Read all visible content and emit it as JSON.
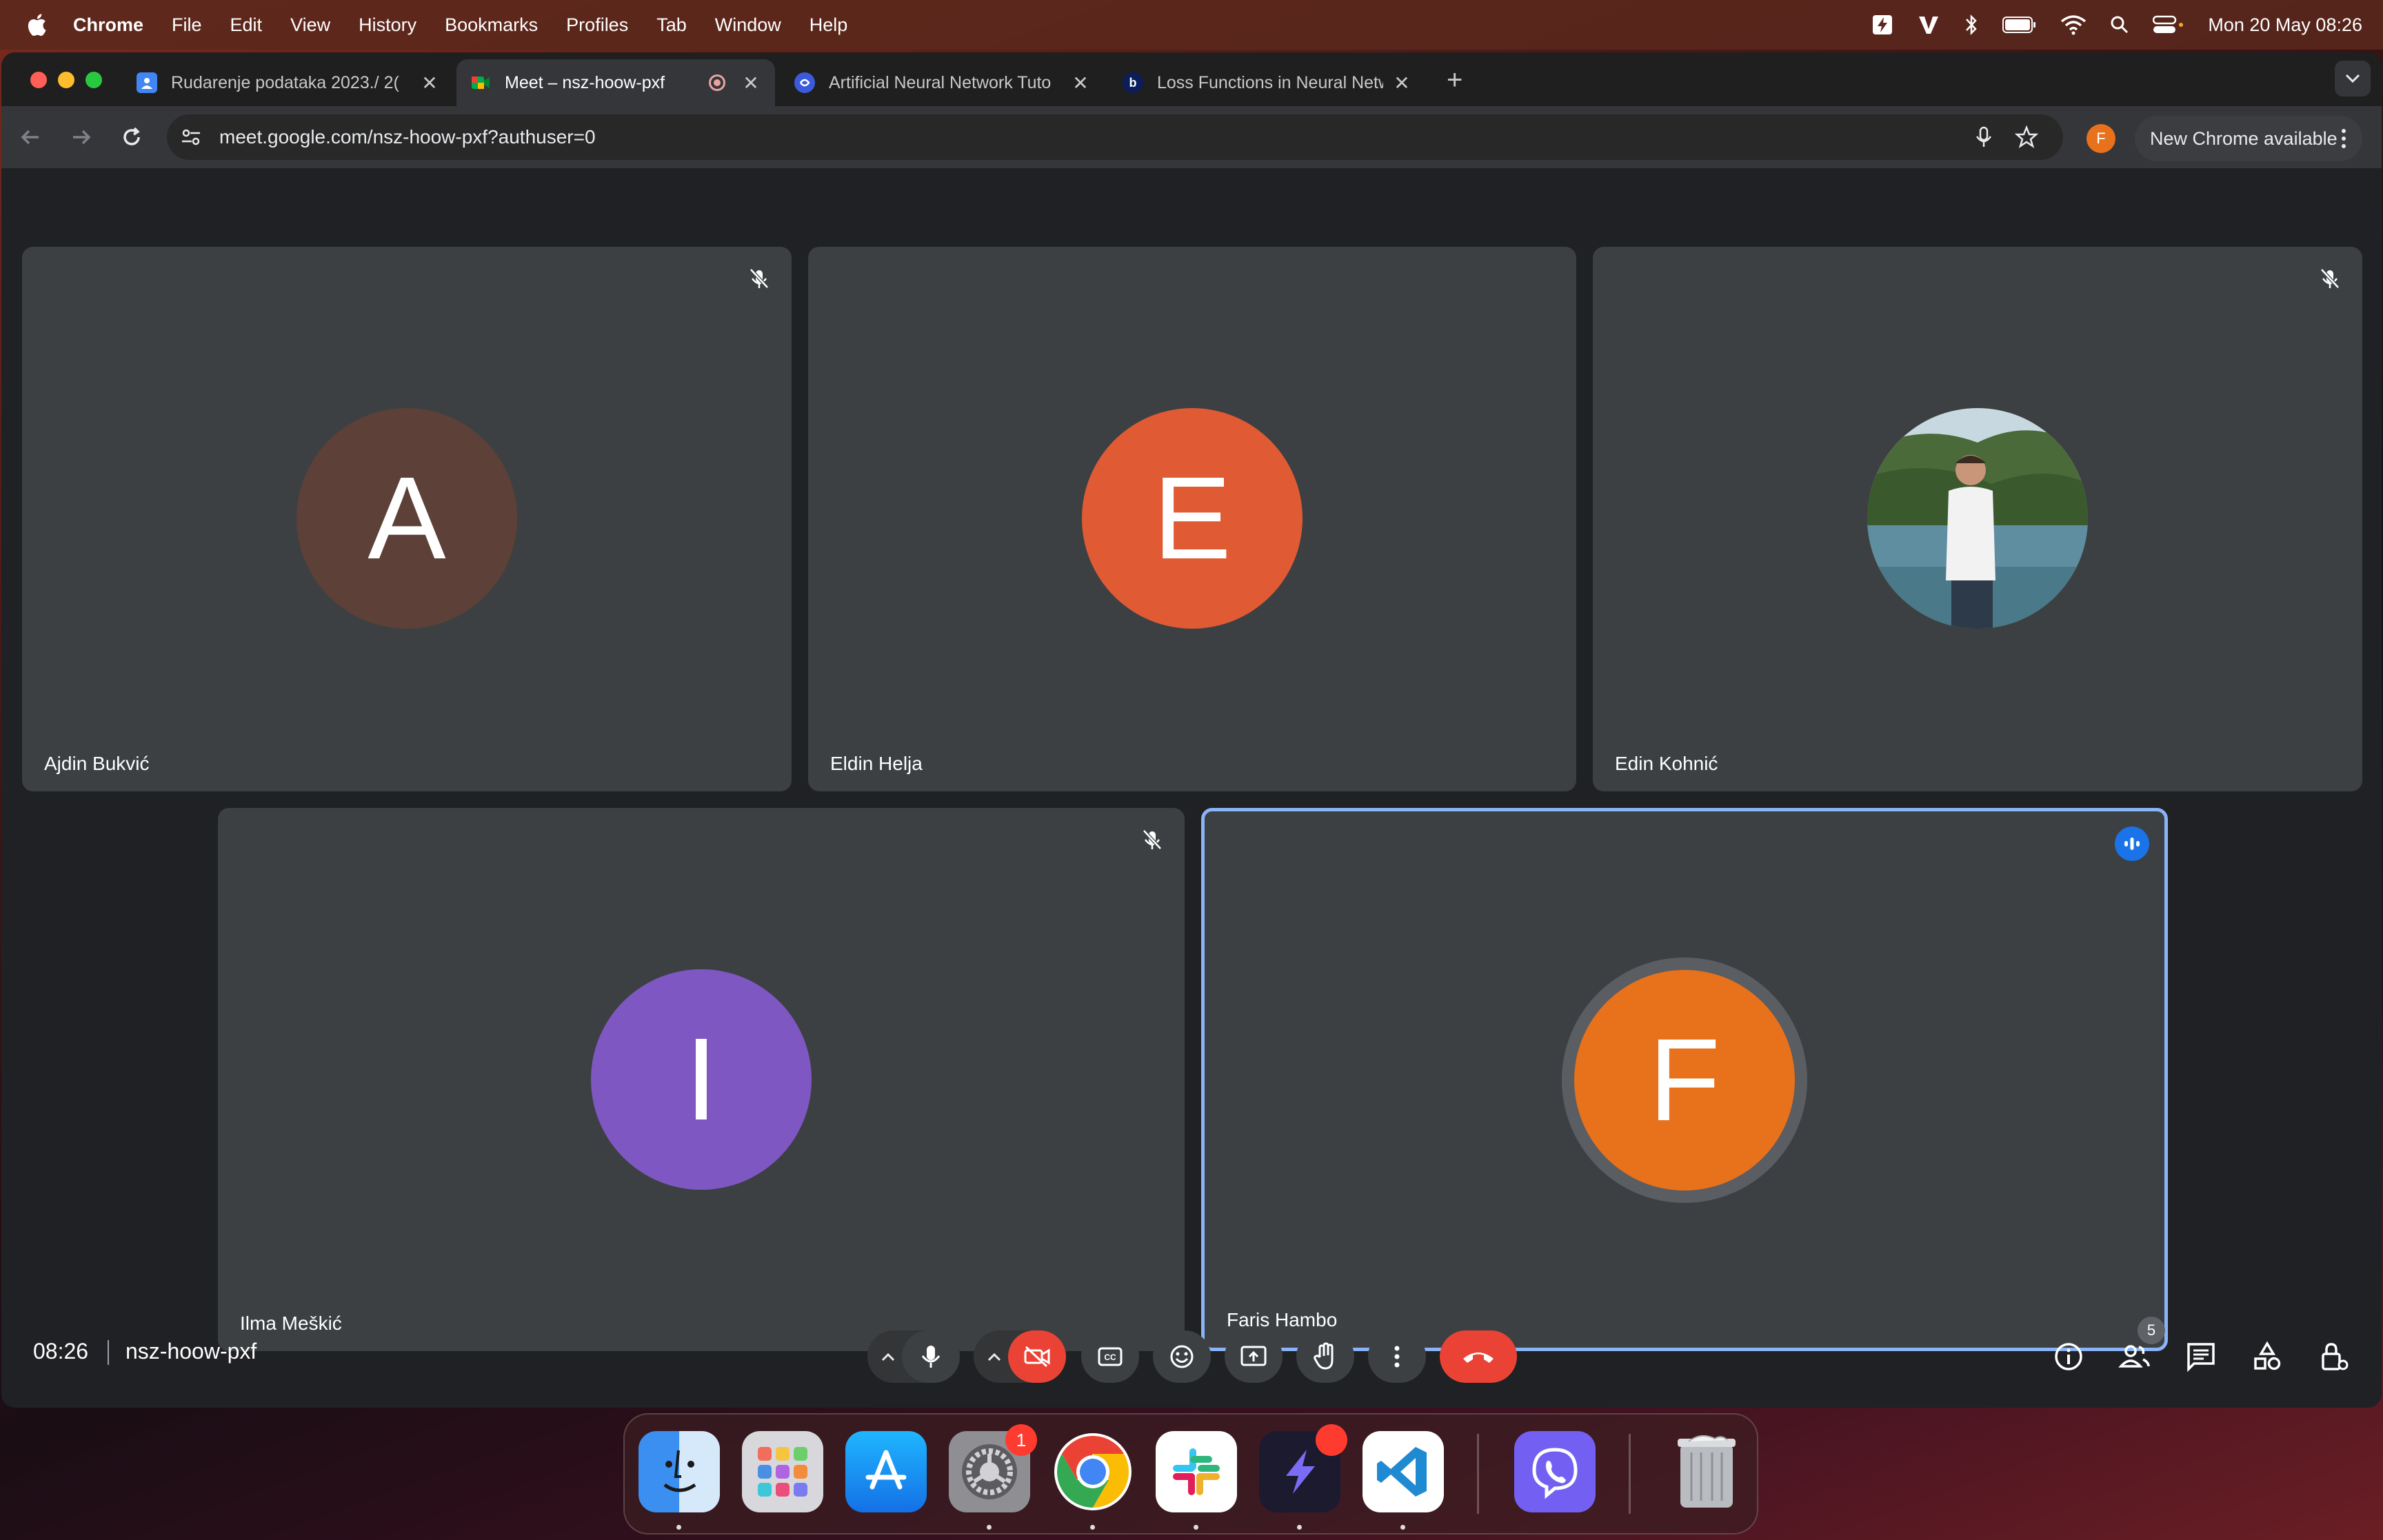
{
  "menubar": {
    "app": "Chrome",
    "items": [
      "File",
      "Edit",
      "View",
      "History",
      "Bookmarks",
      "Profiles",
      "Tab",
      "Window",
      "Help"
    ],
    "datetime": "Mon 20 May  08:26",
    "status_icons": [
      "bolt-icon",
      "vivaldi-icon",
      "bluetooth-icon",
      "battery-icon",
      "wifi-icon",
      "search-icon",
      "control-center-icon"
    ]
  },
  "tabs": [
    {
      "title": "Rudarenje podataka 2023./ 2(",
      "favicon": "classroom-icon",
      "active": false
    },
    {
      "title": "Meet – nsz-hoow-pxf",
      "favicon": "meet-icon",
      "active": true,
      "recording": true
    },
    {
      "title": "Artificial Neural Network Tuto",
      "favicon": "site-icon",
      "active": false
    },
    {
      "title": "Loss Functions in Neural Netw",
      "favicon": "b-icon",
      "active": false
    }
  ],
  "omnibox": {
    "url": "meet.google.com/nsz-hoow-pxf?authuser=0"
  },
  "profile_initial": "F",
  "update_button": "New Chrome available",
  "participants": [
    {
      "name": "Ajdin Bukvić",
      "initial": "A",
      "color": "#5d4037",
      "muted": true
    },
    {
      "name": "Eldin Helja",
      "initial": "E",
      "color": "#e05a33",
      "muted": false
    },
    {
      "name": "Edin Kohnić",
      "initial": "",
      "photo": true,
      "muted": true
    },
    {
      "name": "Ilma Meškić",
      "initial": "I",
      "color": "#7e57c2",
      "muted": true
    },
    {
      "name": "Faris Hambo",
      "initial": "F",
      "color": "#e8711c",
      "speaking": true
    }
  ],
  "meeting": {
    "time": "08:26",
    "code": "nsz-hoow-pxf",
    "participant_count": "5"
  },
  "controls": [
    "mic-options",
    "microphone",
    "camera-options",
    "camera-off",
    "captions",
    "emoji",
    "present",
    "raise-hand",
    "more-options",
    "leave-call"
  ],
  "right_controls": [
    "info-icon",
    "people-icon",
    "chat-icon",
    "activities-icon",
    "host-controls-icon"
  ],
  "dock": {
    "apps": [
      "Finder",
      "Launchpad",
      "App Store",
      "System Settings",
      "Google Chrome",
      "Slack",
      "Linear",
      "Visual Studio Code",
      "Viber",
      "Trash"
    ],
    "settings_badge": "1"
  }
}
